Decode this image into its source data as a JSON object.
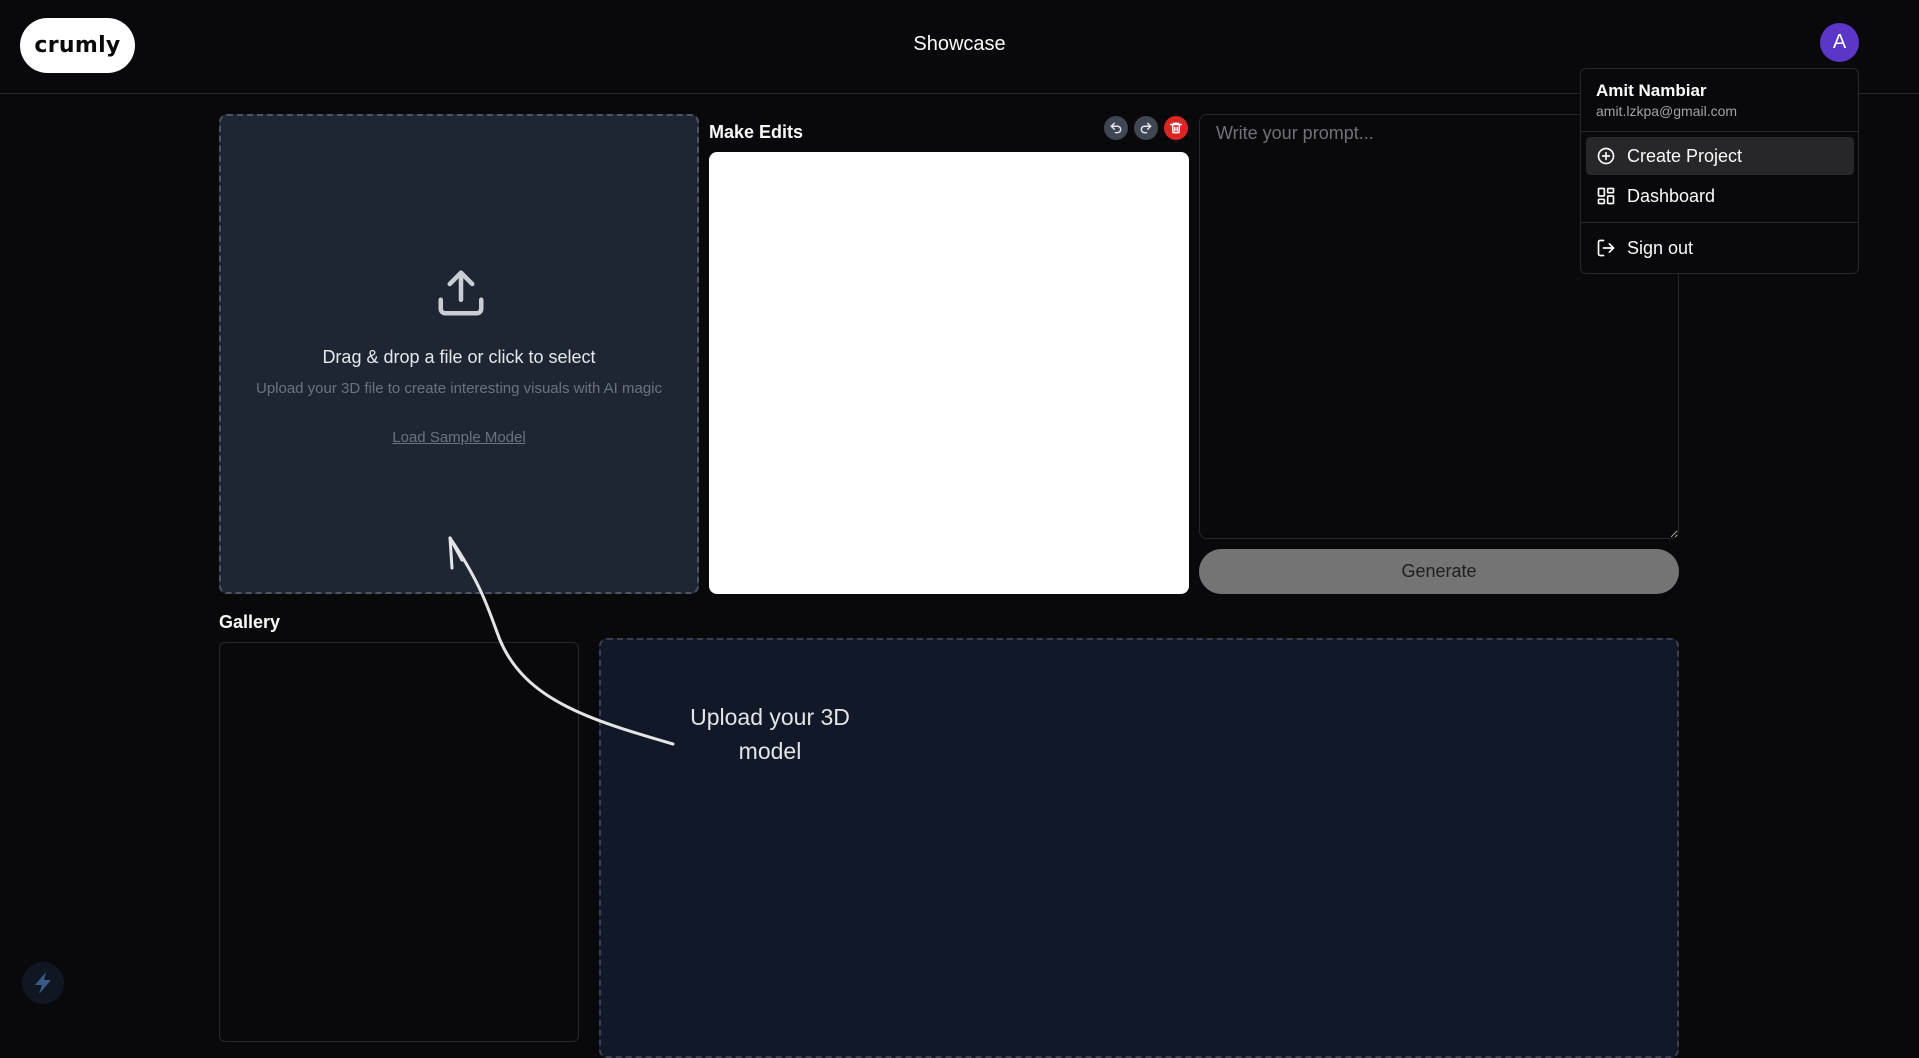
{
  "header": {
    "logo": "crumly",
    "title": "Showcase",
    "avatar_initial": "A"
  },
  "upload": {
    "title": "Drag & drop a file or click to select",
    "subtitle": "Upload your 3D file to create interesting visuals with AI magic",
    "sample_link": "Load Sample Model"
  },
  "editor": {
    "label": "Make Edits",
    "tools": [
      "undo-icon",
      "redo-icon",
      "trash-icon"
    ]
  },
  "prompt": {
    "placeholder": "Write your prompt...",
    "value": ""
  },
  "generate_label": "Generate",
  "gallery": {
    "label": "Gallery"
  },
  "annotation": {
    "text": "Upload your 3D model"
  },
  "user_menu": {
    "name": "Amit Nambiar",
    "email": "amit.lzkpa@gmail.com",
    "items": [
      {
        "label": "Create Project",
        "icon": "plus-circle-icon"
      },
      {
        "label": "Dashboard",
        "icon": "dashboard-icon"
      },
      {
        "label": "Sign out",
        "icon": "sign-out-icon"
      }
    ]
  },
  "colors": {
    "background": "#09090b",
    "avatar": "#5b36c7",
    "dropzone": "#1e2633",
    "delete": "#dc2626",
    "generate_button": "#747474"
  }
}
